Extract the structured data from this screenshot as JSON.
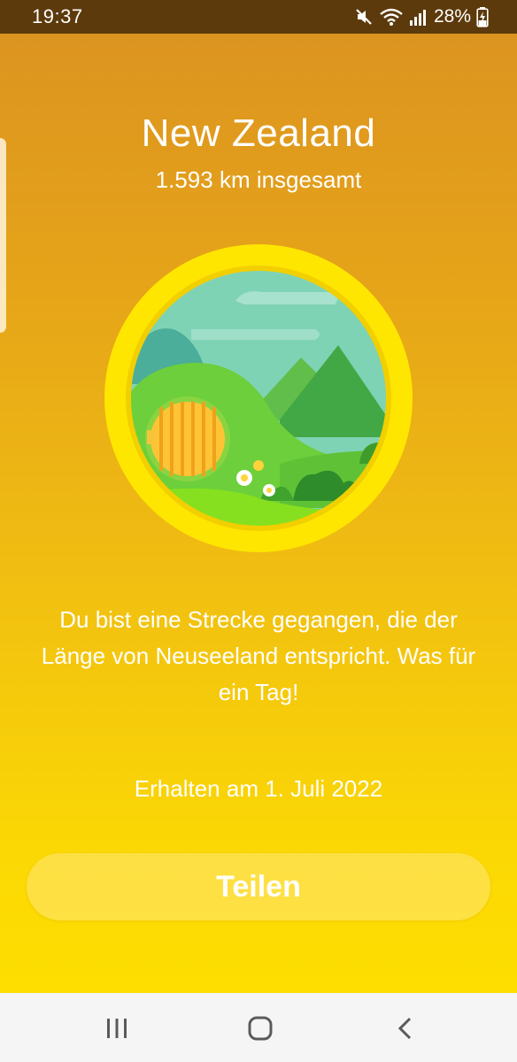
{
  "status_bar": {
    "time": "19:37",
    "battery_percent": "28%",
    "icons": [
      "mute-icon",
      "wifi-icon",
      "signal-icon",
      "battery-charging-icon"
    ]
  },
  "achievement": {
    "title": "New Zealand",
    "subtitle": "1.593 km insgesamt",
    "badge_icon": "hobbit-hill-badge",
    "description": "Du bist eine Strecke gegangen, die der Länge von Neuseeland entspricht. Was für ein Tag!",
    "earned_date": "Erhalten am 1. Juli 2022"
  },
  "actions": {
    "share_label": "Teilen"
  },
  "nav_bar": {
    "buttons": [
      "recent-apps-icon",
      "home-icon",
      "back-icon"
    ]
  },
  "colors": {
    "status_bar": "#5c3a0c",
    "gradient_top": "#dc9420",
    "gradient_bottom": "#fdde00",
    "badge_ring": "#ffe600",
    "text": "#ffffff"
  }
}
